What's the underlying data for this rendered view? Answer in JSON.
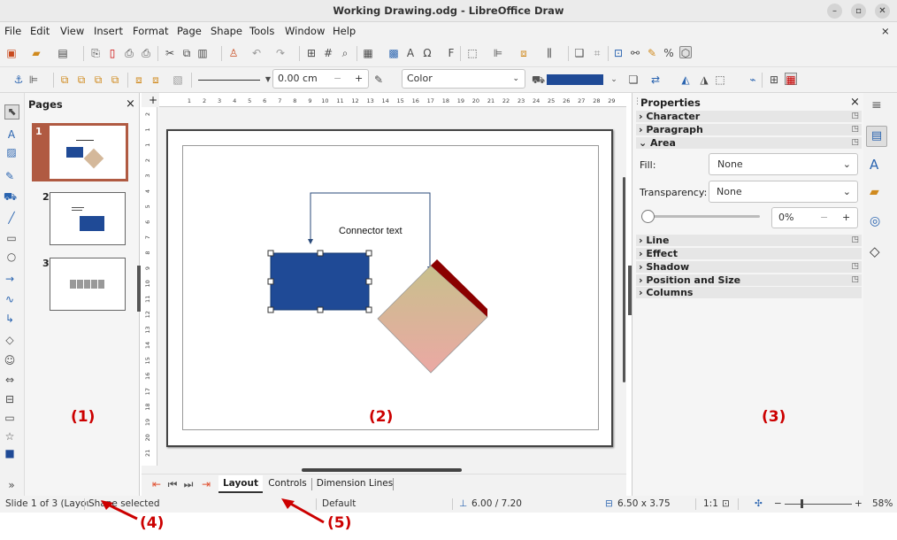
{
  "window": {
    "title": "Working Drawing.odg - LibreOffice Draw",
    "min": "–",
    "max": "▫",
    "close": "✕"
  },
  "menu": [
    "File",
    "Edit",
    "View",
    "Insert",
    "Format",
    "Page",
    "Shape",
    "Tools",
    "Window",
    "Help"
  ],
  "menu_close": "×",
  "toolbar2": {
    "line_width": "0.00 cm",
    "minus": "−",
    "plus": "+",
    "fill_type": "Color"
  },
  "pages_panel": {
    "title": "Pages",
    "close": "×",
    "pages": [
      "1",
      "2",
      "3"
    ]
  },
  "canvas": {
    "connector_text": "Connector text"
  },
  "ruler_h": [
    "1",
    "2",
    "3",
    "4",
    "5",
    "6",
    "7",
    "8",
    "9",
    "10",
    "11",
    "12",
    "13",
    "14",
    "15",
    "16",
    "17",
    "18",
    "19",
    "20",
    "21",
    "22",
    "23",
    "24",
    "25",
    "26",
    "27",
    "28",
    "29"
  ],
  "ruler_v": [
    "2",
    "1",
    "1",
    "2",
    "3",
    "4",
    "5",
    "6",
    "7",
    "8",
    "9",
    "10",
    "11",
    "12",
    "13",
    "14",
    "15",
    "16",
    "17",
    "18",
    "19",
    "20",
    "21"
  ],
  "tabs": {
    "layout": "Layout",
    "controls": "Controls",
    "dimension_lines": "Dimension Lines"
  },
  "sidebar": {
    "title": "Properties",
    "close": "×",
    "menu": "≡",
    "sections": {
      "character": "Character",
      "paragraph": "Paragraph",
      "area": "Area",
      "line": "Line",
      "effect": "Effect",
      "shadow": "Shadow",
      "position_size": "Position and Size",
      "columns": "Columns"
    },
    "fill_label": "Fill:",
    "fill_value": "None",
    "transparency_label": "Transparency:",
    "transparency_value": "None",
    "transparency_percent": "0%",
    "minus": "−",
    "plus": "+"
  },
  "status": {
    "slide": "Slide 1 of 3 (Layout)",
    "selection": "Shape selected",
    "master": "Default",
    "position": "6.00 / 7.20",
    "size": "6.50 x 3.75",
    "scale": "1:1",
    "zoom": "58%"
  },
  "annotations": {
    "a1": "(1)",
    "a2": "(2)",
    "a3": "(3)",
    "a4": "(4)",
    "a5": "(5)"
  },
  "colors": {
    "blue_rect": "#1f4a96",
    "diamond_top": "#c8c08c",
    "diamond_bottom": "#eba8a4",
    "diamond_edge": "#8b0000",
    "annotation": "#cc0000"
  },
  "icons": {
    "select": "arrow-select-icon",
    "textbox": "text-box-icon",
    "pointer": "pointer-icon"
  }
}
